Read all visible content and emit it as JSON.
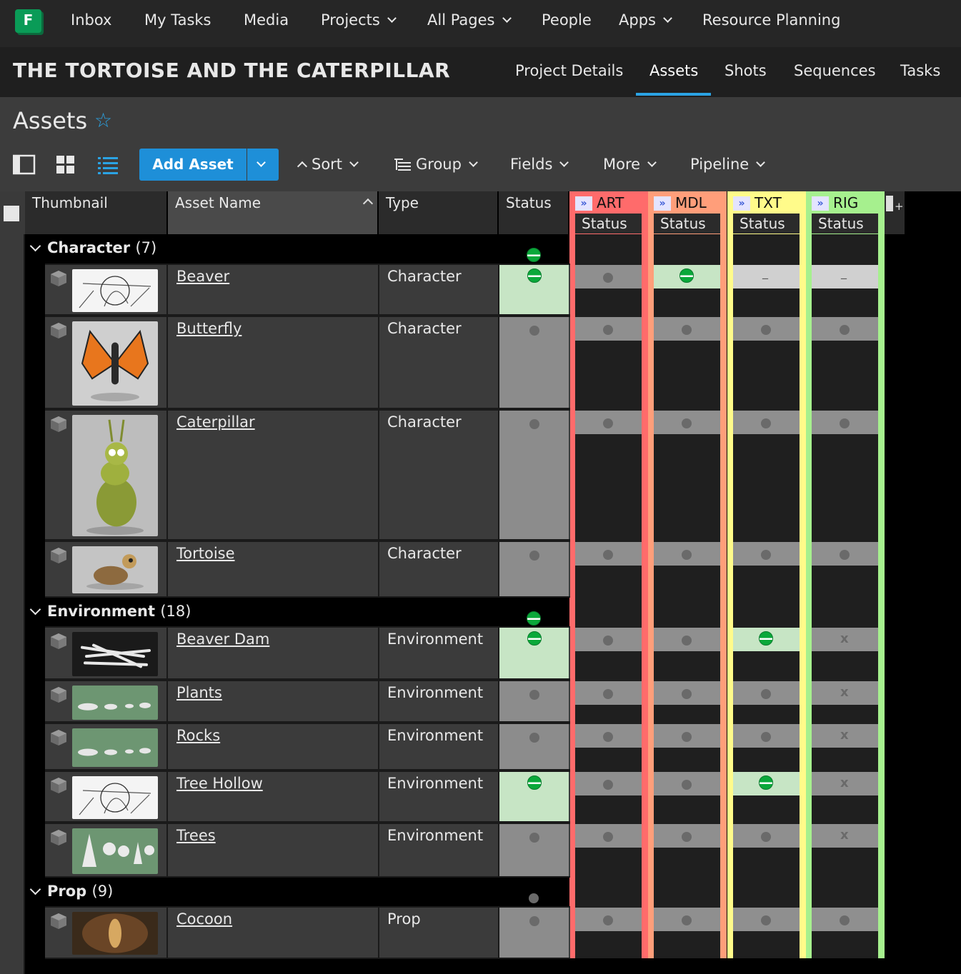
{
  "app": {
    "logo_letter": "F"
  },
  "topnav": {
    "items": [
      {
        "label": "Inbox",
        "dropdown": false
      },
      {
        "label": "My Tasks",
        "dropdown": false
      },
      {
        "label": "Media",
        "dropdown": false
      },
      {
        "label": "Projects",
        "dropdown": true
      },
      {
        "label": "All Pages",
        "dropdown": true
      },
      {
        "label": "People",
        "dropdown": false
      },
      {
        "label": "Apps",
        "dropdown": true
      },
      {
        "label": "Resource Planning",
        "dropdown": false
      }
    ]
  },
  "project": {
    "title": "THE TORTOISE AND THE CATERPILLAR",
    "tabs": [
      {
        "label": "Project Details",
        "active": false
      },
      {
        "label": "Assets",
        "active": true
      },
      {
        "label": "Shots",
        "active": false
      },
      {
        "label": "Sequences",
        "active": false
      },
      {
        "label": "Tasks",
        "active": false
      }
    ]
  },
  "page": {
    "title": "Assets",
    "favorite_icon": "star-outline-icon"
  },
  "toolbar": {
    "add_label": "Add Asset",
    "sort_label": "Sort",
    "group_label": "Group",
    "fields_label": "Fields",
    "more_label": "More",
    "pipeline_label": "Pipeline"
  },
  "columns": {
    "thumbnail": "Thumbnail",
    "asset_name": "Asset Name",
    "type": "Type",
    "status": "Status"
  },
  "steps": [
    {
      "code": "ART",
      "sub": "Status",
      "color": "#ff6b6b"
    },
    {
      "code": "MDL",
      "sub": "Status",
      "color": "#ff9e7a"
    },
    {
      "code": "TXT",
      "sub": "Status",
      "color": "#fffb8a"
    },
    {
      "code": "RIG",
      "sub": "Status",
      "color": "#a6f08e"
    }
  ],
  "status_colors": {
    "in_progress": "#0aa83a",
    "waiting": "#6a6a6a",
    "ip_bg": "#c7e5c5"
  },
  "groups": [
    {
      "name": "Character",
      "count": "(7)",
      "status": "ip",
      "rows": [
        {
          "name": "Beaver",
          "type": "Character",
          "status": "ip",
          "steps": [
            "wtg",
            "ip",
            "na",
            "na"
          ],
          "thumb": "sketch"
        },
        {
          "name": "Butterfly",
          "type": "Character",
          "status": "wtg",
          "steps": [
            "wtg",
            "wtg",
            "wtg",
            "wtg"
          ],
          "thumb": "butterfly"
        },
        {
          "name": "Caterpillar",
          "type": "Character",
          "status": "wtg",
          "steps": [
            "wtg",
            "wtg",
            "wtg",
            "wtg"
          ],
          "thumb": "caterpillar"
        },
        {
          "name": "Tortoise",
          "type": "Character",
          "status": "wtg",
          "steps": [
            "wtg",
            "wtg",
            "wtg",
            "wtg"
          ],
          "thumb": "tortoise"
        }
      ]
    },
    {
      "name": "Environment",
      "count": "(18)",
      "status": "ip",
      "rows": [
        {
          "name": "Beaver Dam",
          "type": "Environment",
          "status": "ip",
          "steps": [
            "wtg",
            "wtg",
            "ip",
            "x"
          ],
          "thumb": "dam"
        },
        {
          "name": "Plants",
          "type": "Environment",
          "status": "wtg",
          "steps": [
            "wtg",
            "wtg",
            "wtg",
            "x"
          ],
          "thumb": "green"
        },
        {
          "name": "Rocks",
          "type": "Environment",
          "status": "wtg",
          "steps": [
            "wtg",
            "wtg",
            "wtg",
            "x"
          ],
          "thumb": "green"
        },
        {
          "name": "Tree Hollow",
          "type": "Environment",
          "status": "ip",
          "steps": [
            "wtg",
            "wtg",
            "ip",
            "x"
          ],
          "thumb": "sketch"
        },
        {
          "name": "Trees",
          "type": "Environment",
          "status": "wtg",
          "steps": [
            "wtg",
            "wtg",
            "wtg",
            "x"
          ],
          "thumb": "trees"
        }
      ]
    },
    {
      "name": "Prop",
      "count": "(9)",
      "status": "wtg",
      "rows": [
        {
          "name": "Cocoon",
          "type": "Prop",
          "status": "wtg",
          "steps": [
            "wtg",
            "wtg",
            "wtg",
            "wtg"
          ],
          "thumb": "cocoon"
        }
      ]
    }
  ],
  "marks": {
    "na": "_",
    "x": "x"
  }
}
